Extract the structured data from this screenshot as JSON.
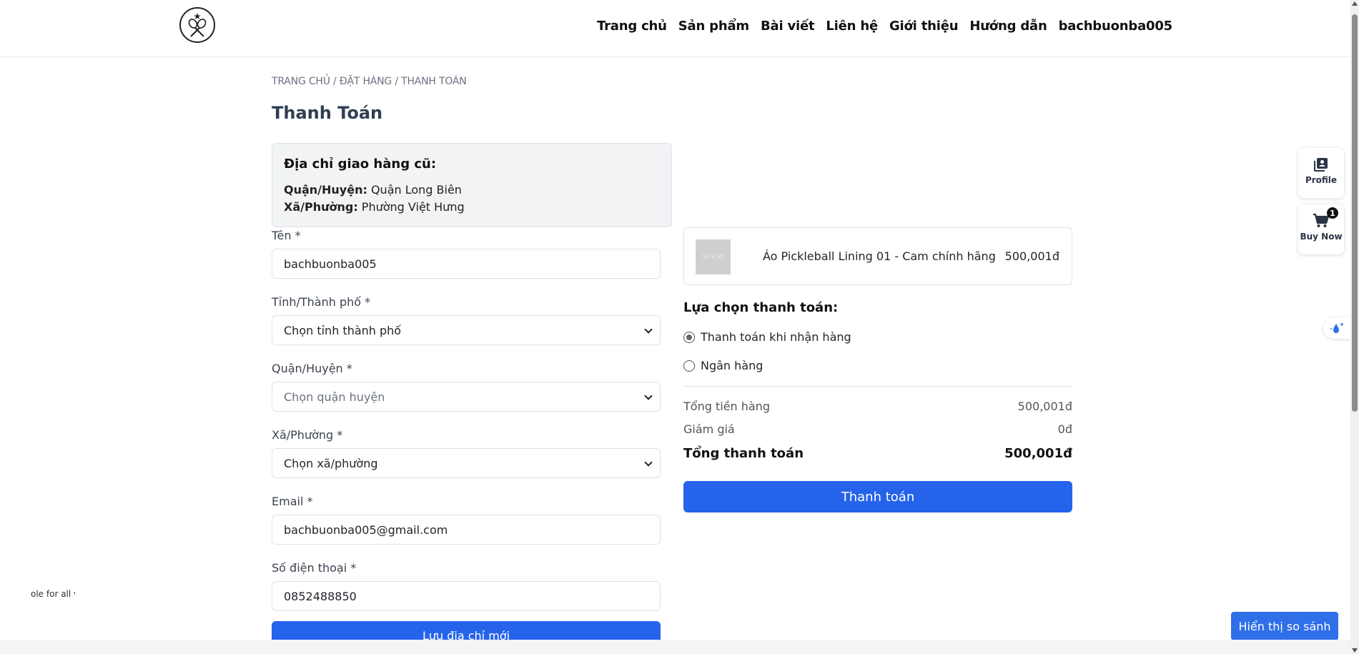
{
  "header": {
    "nav": [
      "Trang chủ",
      "Sản phẩm",
      "Bài viết",
      "Liên hệ",
      "Giới thiệu",
      "Hướng dẫn",
      "bachbuonba005"
    ]
  },
  "breadcrumb": "TRANG CHỦ / ĐẶT HÀNG / THANH TOÁN",
  "page_title": "Thanh Toán",
  "old_address": {
    "title": "Địa chỉ giao hàng cũ:",
    "district_label": "Quận/Huyện:",
    "district_value": " Quận Long Biên",
    "ward_label": "Xã/Phường:",
    "ward_value": " Phường Việt Hưng"
  },
  "form": {
    "name_label": "Tên *",
    "name_value": "bachbuonba005",
    "city_label": "Tỉnh/Thành phố *",
    "city_value": "Chọn tỉnh thành phố",
    "district_label": "Quận/Huyện *",
    "district_value": "Chọn quận huyện",
    "ward_label": "Xã/Phường *",
    "ward_value": "Chọn xã/phường",
    "email_label": "Email *",
    "email_value": "bachbuonba005@gmail.com",
    "phone_label": "Số điện thoại *",
    "phone_value": "0852488850",
    "save_label": "Lưu địa chỉ mới"
  },
  "product": {
    "thumb_text": "50 x 50",
    "name": "Áo Pickleball Lining 01 - Cam chính hãng",
    "price": "500,001đ"
  },
  "payment": {
    "title": "Lựa chọn thanh toán:",
    "options": [
      "Thanh toán khi nhận hàng",
      "Ngân hàng"
    ],
    "selected": 0
  },
  "summary": {
    "subtotal_label": "Tổng tiền hàng",
    "subtotal_value": "500,001đ",
    "discount_label": "Giảm giá",
    "discount_value": "0đ",
    "total_label": "Tổng thanh toán",
    "total_value": "500,001đ"
  },
  "pay_button": "Thanh toán",
  "side": {
    "profile_label": "Profile",
    "buy_label": "Buy Now",
    "cart_count": "1"
  },
  "tiny_text": "ole for all v",
  "compare_button": "Hiển thị so sánh"
}
